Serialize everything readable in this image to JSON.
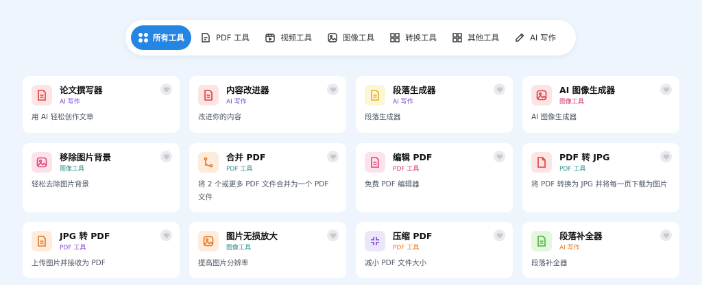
{
  "tabs": [
    {
      "label": "所有工具",
      "icon": "grid-dots-icon",
      "active": true
    },
    {
      "label": "PDF 工具",
      "icon": "pdf-doc-icon"
    },
    {
      "label": "视频工具",
      "icon": "video-icon"
    },
    {
      "label": "图像工具",
      "icon": "image-icon"
    },
    {
      "label": "转换工具",
      "icon": "grid-squares-icon"
    },
    {
      "label": "其他工具",
      "icon": "grid-squares-icon"
    },
    {
      "label": "AI 写作",
      "icon": "pen-icon"
    }
  ],
  "cards": [
    {
      "title": "论文撰写器",
      "tag": "AI 写作",
      "desc": "用 AI 轻松创作文章"
    },
    {
      "title": "内容改进器",
      "tag": "AI 写作",
      "desc": "改进你的内容"
    },
    {
      "title": "段落生成器",
      "tag": "AI 写作",
      "desc": "段落生成器"
    },
    {
      "title": "AI 图像生成器",
      "tag": "图像工具",
      "desc": "AI 图像生成器"
    },
    {
      "title": "移除图片背景",
      "tag": "图像工具",
      "desc": "轻松去除图片背景"
    },
    {
      "title": "合并 PDF",
      "tag": "PDF 工具",
      "desc": "将 2 个或更多 PDF 文件合并为一个 PDF 文件"
    },
    {
      "title": "编辑 PDF",
      "tag": "PDF 工具",
      "desc": "免费 PDF 编辑器"
    },
    {
      "title": "PDF 转 JPG",
      "tag": "PDF 工具",
      "desc": "将 PDF 转换为 JPG 并将每一页下载为图片"
    },
    {
      "title": "JPG 转 PDF",
      "tag": "PDF 工具",
      "desc": "上传图片并接收为 PDF"
    },
    {
      "title": "图片无损放大",
      "tag": "图像工具",
      "desc": "提高图片分辨率"
    },
    {
      "title": "压缩 PDF",
      "tag": "PDF 工具",
      "desc": "减小 PDF 文件大小"
    },
    {
      "title": "段落补全器",
      "tag": "AI 写作",
      "desc": "段落补全器"
    }
  ],
  "colors": {
    "accent": "#2585e3",
    "page_bg": "#eef5fd",
    "tag_ai_purple": "#7b45d8",
    "tag_image_pink": "#d8336d",
    "tag_pdf_teal": "#2f8f8a",
    "tag_ai_orange": "#e8771d"
  }
}
